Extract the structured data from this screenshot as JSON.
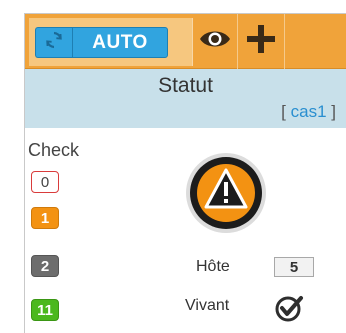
{
  "toolbar": {
    "refresh_icon": "refresh-icon",
    "auto_label": "AUTO",
    "eye_icon": "eye-icon",
    "plus_icon": "plus-icon",
    "accent_color": "#f0a33a",
    "button_color": "#31a4df"
  },
  "status": {
    "title": "Statut",
    "case_prefix": "[ ",
    "case_name": "cas1",
    "case_suffix": " ]",
    "icon": "warning-icon"
  },
  "check": {
    "label": "Check",
    "counts": [
      {
        "value": "0",
        "color": "#d93b3b"
      },
      {
        "value": "1",
        "color": "#f39212"
      },
      {
        "value": "2",
        "color": "#6d6d6d"
      },
      {
        "value": "11",
        "color": "#4bb81e"
      }
    ]
  },
  "host": {
    "label": "Hôte",
    "count": "5"
  },
  "alive": {
    "label": "Vivant",
    "icon": "check-circle-icon"
  }
}
